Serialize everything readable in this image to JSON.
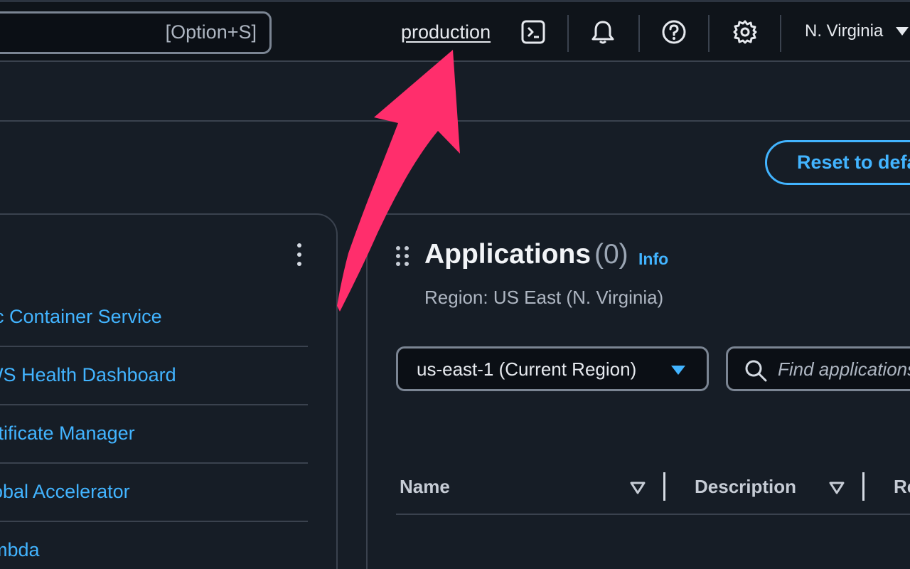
{
  "topnav": {
    "search_shortcut": "[Option+S]",
    "profile_label": "production",
    "icons": [
      "cloudshell-icon",
      "bell-icon",
      "help-icon",
      "gear-icon"
    ],
    "region_label": "N. Virginia"
  },
  "actions": {
    "reset_label": "Reset to default layout"
  },
  "recent_services": {
    "items": [
      {
        "label": "Elastic Container Service"
      },
      {
        "label": "AWS Health Dashboard"
      },
      {
        "label": "Certificate Manager"
      },
      {
        "label": "Global Accelerator"
      },
      {
        "label": "Lambda"
      }
    ]
  },
  "applications": {
    "title": "Applications",
    "count": "(0)",
    "info_label": "Info",
    "region_text": "Region: US East (N. Virginia)",
    "region_dropdown_value": "us-east-1 (Current Region)",
    "find_placeholder": "Find applications",
    "columns": [
      "Name",
      "Description",
      "Region"
    ]
  },
  "colors": {
    "accent": "#42b4ff",
    "annotation_arrow": "#ff2e6c",
    "background": "#161d26",
    "nav_background": "#0f141a"
  }
}
